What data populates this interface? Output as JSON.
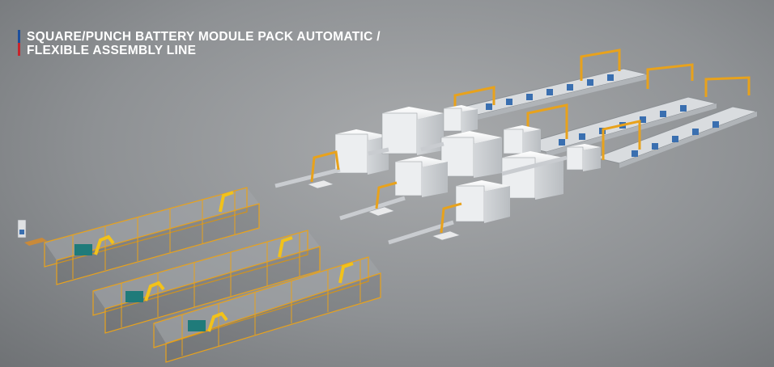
{
  "title": {
    "line1": "SQUARE/PUNCH  BATTERY MODULE PACK AUTOMATIC /",
    "line2": "FLEXIBLE ASSEMBLY LINE"
  },
  "colors": {
    "accent_blue": "#1c4f9c",
    "accent_red": "#c8242b",
    "fence_orange": "#e8a21c",
    "robot_yellow": "#f2c21a",
    "machine_white": "#eef0f2",
    "pallet_teal": "#1f7b7a"
  },
  "scene": {
    "description_icon": "factory-assembly-line-illustration"
  }
}
